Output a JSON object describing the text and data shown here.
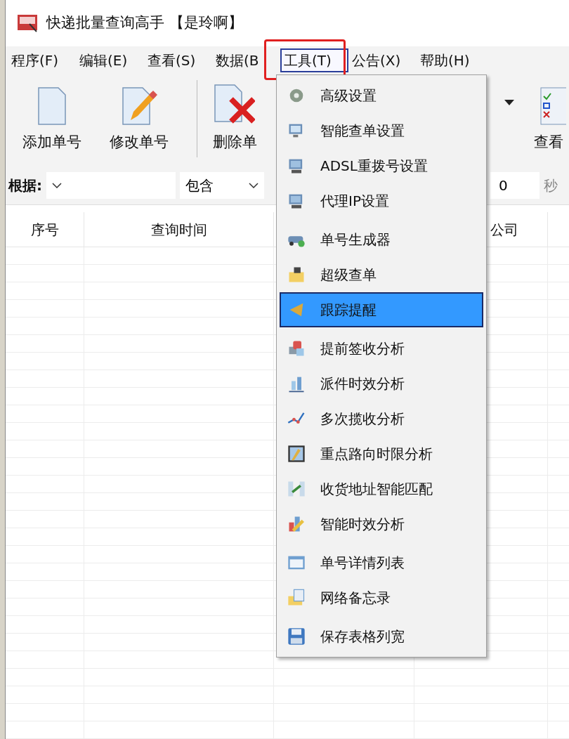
{
  "window": {
    "title": "快递批量查询高手 【是玲啊】"
  },
  "menu_bar": [
    {
      "label": "程序(F)",
      "selected": false
    },
    {
      "label": "编辑(E)",
      "selected": false
    },
    {
      "label": "查看(S)",
      "selected": false
    },
    {
      "label": "数据(B",
      "selected": false
    },
    {
      "label": "工具(T)",
      "selected": true
    },
    {
      "label": "公告(X)",
      "selected": false
    },
    {
      "label": "帮助(H)",
      "selected": false
    }
  ],
  "toolbar": [
    {
      "label": "添加单号",
      "kind": "add"
    },
    {
      "label": "修改单号",
      "kind": "edit"
    },
    {
      "label": "删除单",
      "kind": "delete"
    }
  ],
  "toolbar_right": {
    "label": "查看"
  },
  "filter": {
    "label": "根据:",
    "match_combo": {
      "value": "包含"
    },
    "seconds_field": {
      "value": "0"
    },
    "seconds_label": "秒"
  },
  "table": {
    "columns": [
      "序号",
      "查询时间",
      "公司"
    ]
  },
  "tools_menu": [
    {
      "kind": "item",
      "label": "高级设置",
      "selected": false
    },
    {
      "kind": "item",
      "label": "智能查单设置",
      "selected": false
    },
    {
      "kind": "item",
      "label": "ADSL重拨号设置",
      "selected": false
    },
    {
      "kind": "item",
      "label": "代理IP设置",
      "selected": false
    },
    {
      "kind": "separator"
    },
    {
      "kind": "item",
      "label": "单号生成器",
      "selected": false
    },
    {
      "kind": "item",
      "label": "超级查单",
      "selected": false
    },
    {
      "kind": "item",
      "label": "跟踪提醒",
      "selected": true
    },
    {
      "kind": "separator"
    },
    {
      "kind": "item",
      "label": "提前签收分析",
      "selected": false
    },
    {
      "kind": "item",
      "label": "派件时效分析",
      "selected": false
    },
    {
      "kind": "item",
      "label": "多次揽收分析",
      "selected": false
    },
    {
      "kind": "item",
      "label": "重点路向时限分析",
      "selected": false
    },
    {
      "kind": "item",
      "label": "收货地址智能匹配",
      "selected": false
    },
    {
      "kind": "item",
      "label": "智能时效分析",
      "selected": false
    },
    {
      "kind": "separator"
    },
    {
      "kind": "item",
      "label": "单号详情列表",
      "selected": false
    },
    {
      "kind": "item",
      "label": "网络备忘录",
      "selected": false
    },
    {
      "kind": "separator"
    },
    {
      "kind": "item",
      "label": "保存表格列宽",
      "selected": false
    }
  ]
}
